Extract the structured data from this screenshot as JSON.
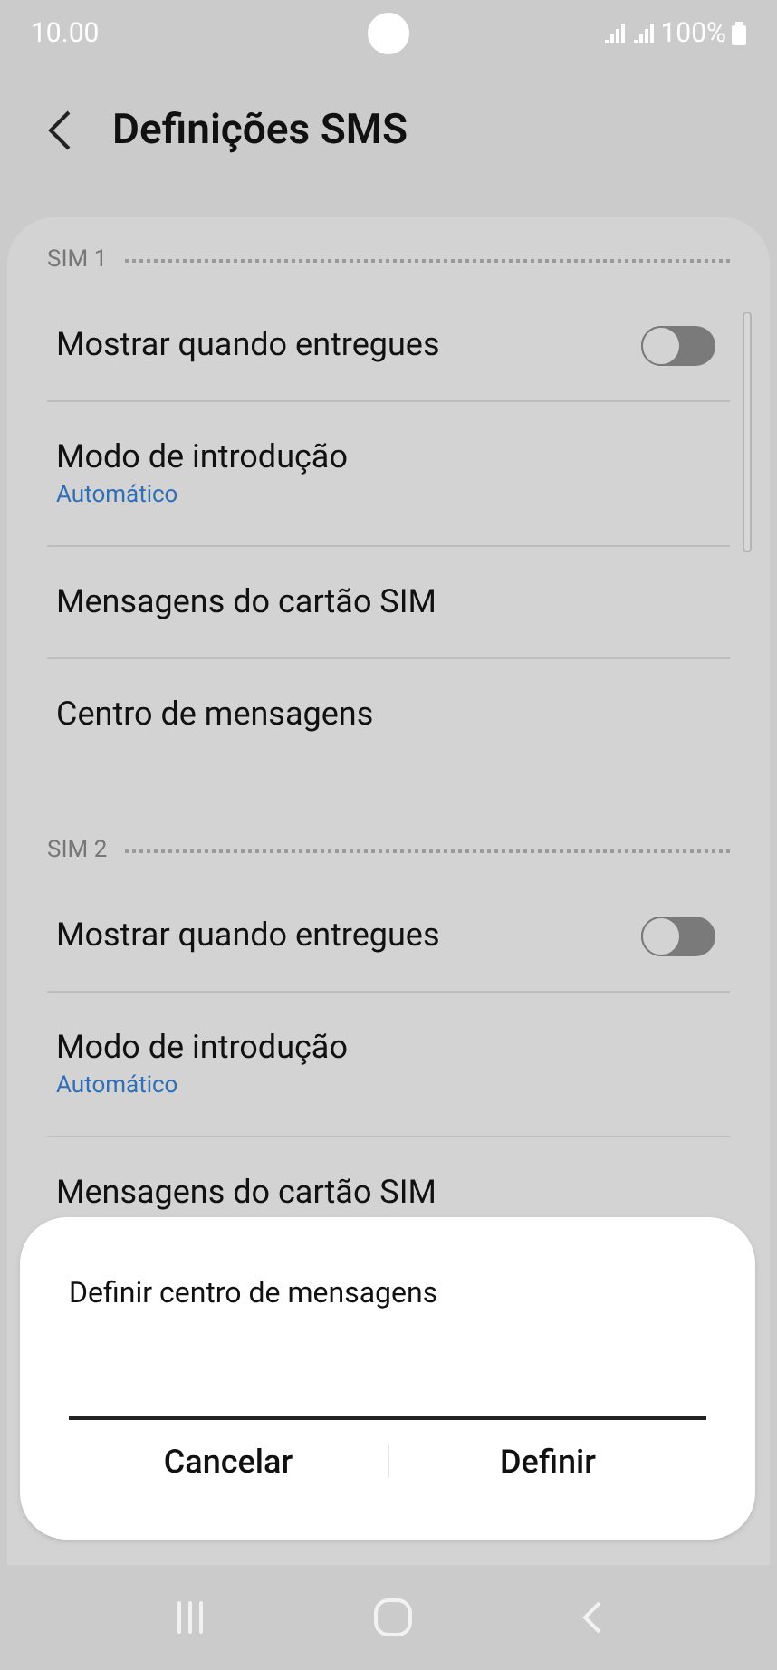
{
  "status_bar": {
    "time": "10.00",
    "battery": "100%"
  },
  "header": {
    "title": "Definições SMS"
  },
  "sections": [
    {
      "title": "SIM 1",
      "items": [
        {
          "kind": "toggle",
          "label": "Mostrar quando entregues",
          "on": false
        },
        {
          "kind": "value",
          "label": "Modo de introdução",
          "value": "Automático"
        },
        {
          "kind": "plain",
          "label": "Mensagens do cartão SIM"
        },
        {
          "kind": "plain",
          "label": "Centro de mensagens"
        }
      ]
    },
    {
      "title": "SIM 2",
      "items": [
        {
          "kind": "toggle",
          "label": "Mostrar quando entregues",
          "on": false
        },
        {
          "kind": "value",
          "label": "Modo de introdução",
          "value": "Automático"
        },
        {
          "kind": "plain",
          "label": "Mensagens do cartão SIM"
        }
      ]
    }
  ],
  "dialog": {
    "title": "Definir centro de mensagens",
    "buttons": [
      "Cancelar",
      "Definir"
    ]
  }
}
